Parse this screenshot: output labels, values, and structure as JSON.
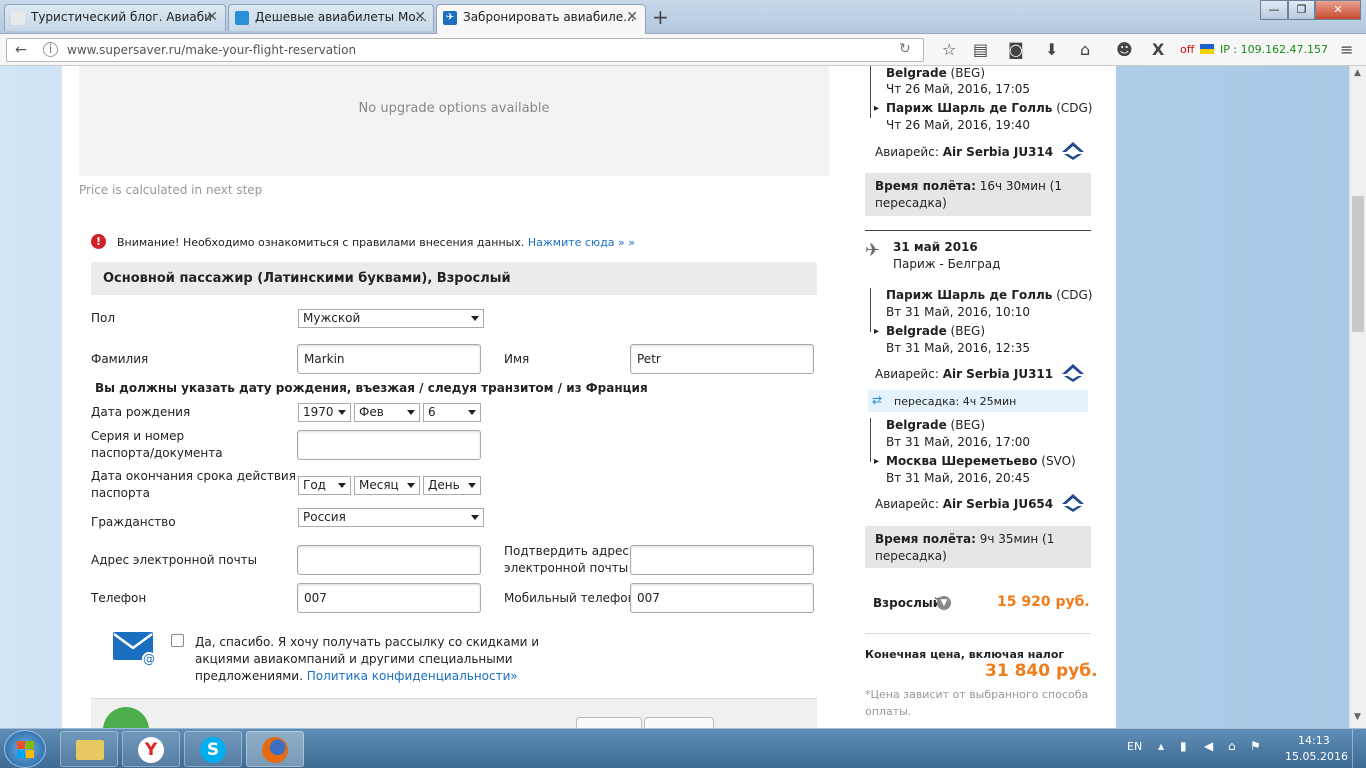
{
  "browser": {
    "tabs": [
      {
        "label": "Туристический блог. Авиаби"
      },
      {
        "label": "Дешевые авиабилеты Мо..."
      },
      {
        "label": "Забронировать авиабиле..."
      }
    ],
    "url": "www.supersaver.ru/make-your-flight-reservation",
    "ip_label": "IP : 109.162.47.157",
    "off_label": "off"
  },
  "upgrade": {
    "text": "No upgrade options available",
    "price_note": "Price is calculated in next step"
  },
  "warning": {
    "text": "Внимание! Необходимо ознакомиться с правилами внесения данных. ",
    "link": "Нажмите сюда » »"
  },
  "passenger": {
    "header": "Основной пассажир (Латинскими буквами), Взрослый",
    "gender_label": "Пол",
    "gender_value": "Мужской",
    "lastname_label": "Фамилия",
    "lastname_value": "Markin",
    "firstname_label": "Имя",
    "firstname_value": "Petr",
    "dob_notice": "Вы должны указать дату рождения, въезжая / следуя транзитом / из Франция",
    "dob_label": "Дата рождения",
    "dob_year": "1970",
    "dob_month": "Фев",
    "dob_day": "6",
    "passport_label_1": "Серия и номер",
    "passport_label_2": "паспорта/документа",
    "expiry_label_1": "Дата окончания срока действия",
    "expiry_label_2": "паспорта",
    "expiry_year": "Год",
    "expiry_month": "Месяц",
    "expiry_day": "День",
    "citizenship_label": "Гражданство",
    "citizenship_value": "Россия",
    "email_label": "Адрес электронной почты",
    "email_confirm_label_1": "Подтвердить адрес",
    "email_confirm_label_2": "электронной почты",
    "phone_label": "Телефон",
    "phone_value": "007",
    "mobile_label": "Мобильный телефон",
    "mobile_value": "007"
  },
  "newsletter": {
    "line1": "Да, спасибо. Я хочу получать рассылку со скидками и",
    "line2": "акциями авиакомпаний и другими специальными",
    "line3": "предложениями. ",
    "link": "Политика конфиденциальности»"
  },
  "sidebar": {
    "seg1": {
      "from_city": "Belgrade",
      "from_code": " (BEG)",
      "from_time": "Чт 26 Май, 2016, 17:05",
      "to_city": "Париж Шарль де Голль",
      "to_code": " (CDG)",
      "to_time": "Чт 26 Май, 2016, 19:40",
      "flight_label": "Авиарейс: ",
      "flight": "Air Serbia JU314"
    },
    "duration1_label": "Время полёта:",
    "duration1_value": " 16ч 30мин (1",
    "duration1_value2": "пересадка)",
    "return_date": "31 май 2016",
    "return_route": "Париж - Белград",
    "seg2": {
      "from_city": "Париж Шарль де Голль",
      "from_code": " (CDG)",
      "from_time": "Вт 31 Май, 2016, 10:10",
      "to_city": "Belgrade",
      "to_code": " (BEG)",
      "to_time": "Вт 31 Май, 2016, 12:35",
      "flight_label": "Авиарейс: ",
      "flight": "Air Serbia JU311"
    },
    "transfer": "пересадка: 4ч 25мин",
    "seg3": {
      "from_city": "Belgrade",
      "from_code": " (BEG)",
      "from_time": "Вт 31 Май, 2016, 17:00",
      "to_city": "Москва Шереметьево",
      "to_code": " (SVO)",
      "to_time": "Вт 31 Май, 2016, 20:45",
      "flight_label": "Авиарейс: ",
      "flight": "Air Serbia JU654"
    },
    "duration2_label": "Время полёта:",
    "duration2_value": " 9ч 35мин (1",
    "duration2_value2": "пересадка)",
    "adult_label": "Взрослый",
    "adult_price": "15 920 руб.",
    "final_label": "Конечная цена, включая налог",
    "final_price": "31 840 руб.",
    "price_note_1": "*Цена зависит от выбранного способа",
    "price_note_2": "оплаты."
  },
  "taskbar": {
    "lang": "EN",
    "time": "14:13",
    "date": "15.05.2016"
  },
  "colors": {
    "accent_link": "#1a6fc0",
    "price_orange": "#f07c1b",
    "warning_red": "#d0212a"
  }
}
